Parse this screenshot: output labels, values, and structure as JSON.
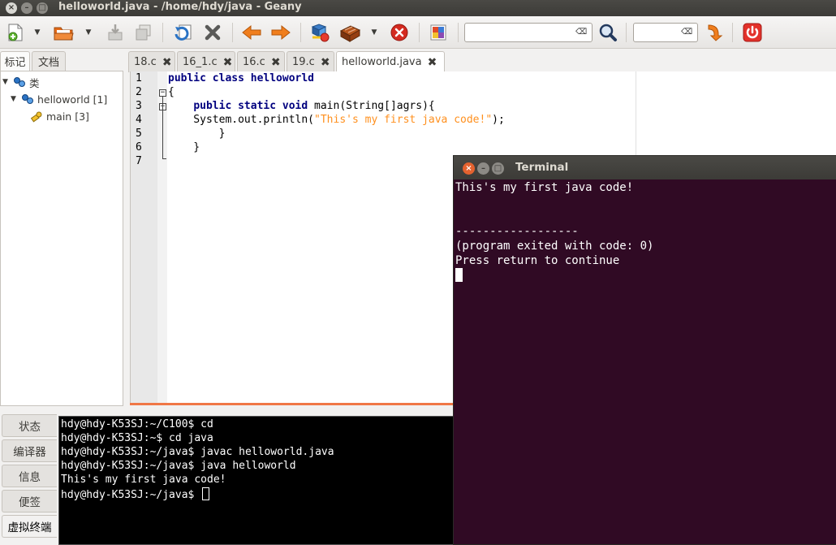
{
  "window": {
    "title": "helloworld.java - /home/hdy/java - Geany",
    "close_glyph": "×",
    "min_glyph": "–",
    "max_glyph": "□"
  },
  "toolbar": {
    "search_value": "",
    "goto_value": "",
    "clear_glyph": "⌫"
  },
  "sidebar": {
    "tabs": [
      "标记",
      "文档"
    ],
    "tree": [
      {
        "label": "类"
      },
      {
        "label": "helloworld [1]"
      },
      {
        "label": "main [3]"
      }
    ]
  },
  "editor": {
    "tabs": [
      {
        "label": "18.c"
      },
      {
        "label": "16_1.c"
      },
      {
        "label": "16.c"
      },
      {
        "label": "19.c"
      },
      {
        "label": "helloworld.java"
      }
    ],
    "tab_close_glyph": "✖",
    "line_numbers": [
      "1",
      "2",
      "3",
      "4",
      "5",
      "6",
      "7"
    ],
    "code": {
      "l1_kw": "public class helloworld",
      "l2": "{",
      "l3_indent": "    ",
      "l3_kw": "public static void",
      "l3_rest": " main(String[]agrs){",
      "l4_pre": "    System.out.println(",
      "l4_str": "\"This's my first java code!\"",
      "l4_post": ");",
      "l5": "        }",
      "l6": "    }"
    },
    "fold_minus": "−"
  },
  "bottom_panel": {
    "tabs": [
      "状态",
      "编译器",
      "信息",
      "便签",
      "虚拟终端"
    ],
    "vte_lines": [
      "hdy@hdy-K53SJ:~/C100$ cd",
      "hdy@hdy-K53SJ:~$ cd java",
      "hdy@hdy-K53SJ:~/java$ javac helloworld.java",
      "hdy@hdy-K53SJ:~/java$ java helloworld",
      "This's my first java code!",
      "hdy@hdy-K53SJ:~/java$ "
    ]
  },
  "terminal": {
    "title": "Terminal",
    "lines": [
      "This's my first java code!",
      "",
      "",
      "------------------",
      "(program exited with code: 0)",
      "Press return to continue"
    ]
  },
  "colors": {
    "terminal_bg": "#300a24",
    "keyword": "#00007f",
    "string": "#ff901e",
    "accent_bar": "#f07746"
  }
}
